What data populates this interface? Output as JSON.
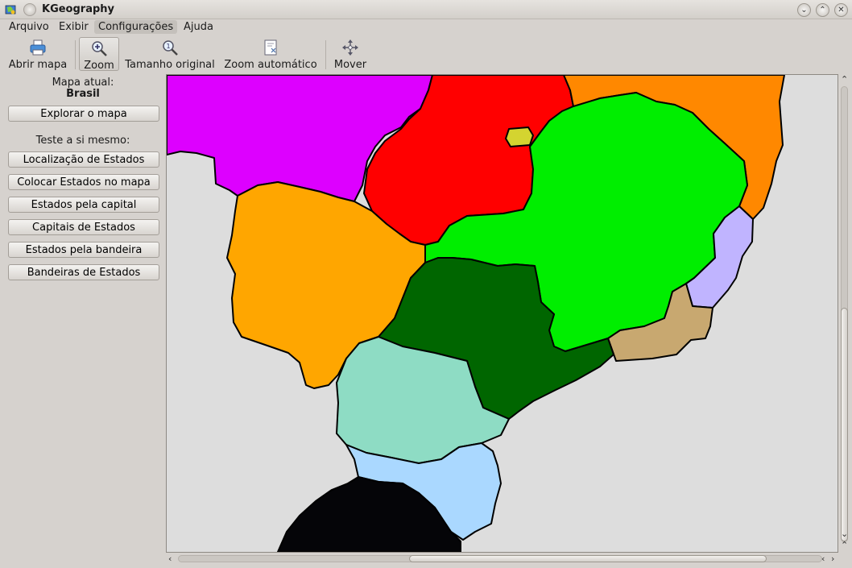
{
  "window": {
    "title": "KGeography"
  },
  "menu": [
    "Arquivo",
    "Exibir",
    "Configurações",
    "Ajuda"
  ],
  "toolbar": {
    "open_map": "Abrir mapa",
    "zoom": "Zoom",
    "original_size": "Tamanho original",
    "auto_zoom": "Zoom automático",
    "move": "Mover"
  },
  "sidebar": {
    "current_map_label": "Mapa atual:",
    "current_map_name": "Brasil",
    "explore_button": "Explorar o mapa",
    "test_label": "Teste a si mesmo:",
    "quiz_buttons": [
      "Localização de Estados",
      "Colocar Estados no mapa",
      "Estados pela capital",
      "Capitais de Estados",
      "Estados pela bandeira",
      "Bandeiras de Estados"
    ]
  },
  "map": {
    "background": "#dddddd",
    "regions": [
      {
        "name": "magenta-region",
        "color": "#dd00ff"
      },
      {
        "name": "red-region",
        "color": "#ff0000"
      },
      {
        "name": "orange-region",
        "color": "#ff8800"
      },
      {
        "name": "bright-green-region",
        "color": "#00ee00"
      },
      {
        "name": "yellow-region",
        "color": "#d4d430"
      },
      {
        "name": "light-orange-region",
        "color": "#ffa600"
      },
      {
        "name": "lavender-region",
        "color": "#c0b4ff"
      },
      {
        "name": "tan-region",
        "color": "#c8a870"
      },
      {
        "name": "dark-green-region",
        "color": "#006600"
      },
      {
        "name": "mint-region",
        "color": "#8edcc4"
      },
      {
        "name": "light-blue-region",
        "color": "#aad8ff"
      },
      {
        "name": "black-region",
        "color": "#050508"
      }
    ]
  }
}
